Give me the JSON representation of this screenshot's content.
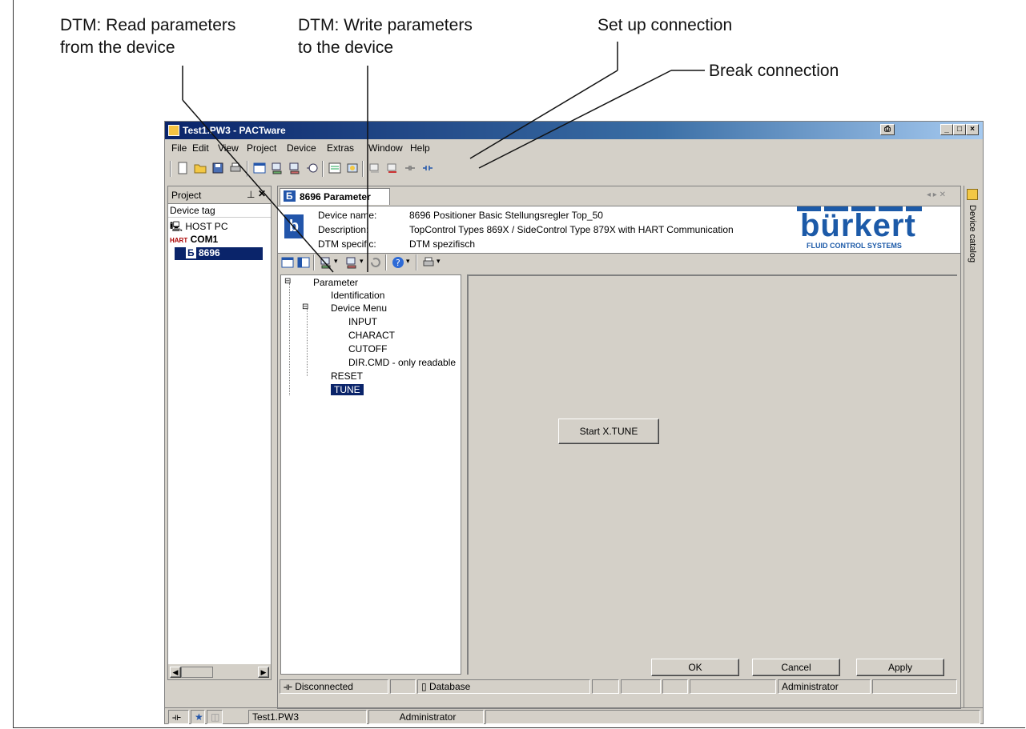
{
  "callouts": {
    "read_params": [
      "DTM: Read parameters",
      "from the device"
    ],
    "write_params": [
      "DTM: Write parameters",
      "to the device"
    ],
    "setup_conn": "Set up connection",
    "break_conn": "Break connection"
  },
  "window": {
    "title": "Test1.PW3 - PACTware",
    "buttons": [
      "_",
      "□",
      "×"
    ]
  },
  "menu": [
    "File",
    "Edit",
    "View",
    "Project",
    "Device",
    "Extras",
    "Window",
    "Help"
  ],
  "project_pane": {
    "title": "Project",
    "column_header": "Device tag",
    "tree": [
      {
        "label": "HOST PC",
        "icon": "computer-icon"
      },
      {
        "label": "COM1",
        "prefix": "HART",
        "icon": "hart-icon"
      },
      {
        "label": "8696",
        "icon": "device-icon",
        "selected": true
      }
    ]
  },
  "param_tab": {
    "label": "8696 Parameter"
  },
  "device_info": {
    "name_label": "Device name:",
    "name_value": "8696 Positioner Basic Stellungsregler Top_50",
    "desc_label": "Description:",
    "desc_value": "TopControl Types 869X / SideControl Type 879X  with HART Communication",
    "dtm_label": "DTM specific:",
    "dtm_value": "DTM spezifisch",
    "logo": "bürkert",
    "logo_sub": "FLUID CONTROL SYSTEMS"
  },
  "param_tree": {
    "root": "Parameter",
    "items": [
      "Identification",
      "Device Menu",
      "INPUT",
      "CHARACT",
      "CUTOFF",
      "DIR.CMD - only readable",
      "RESET",
      "TUNE"
    ]
  },
  "content": {
    "start_button": "Start X.TUNE"
  },
  "dialog_buttons": {
    "ok": "OK",
    "cancel": "Cancel",
    "apply": "Apply"
  },
  "statusbar": {
    "connection": "Disconnected",
    "database": "Database",
    "user": "Administrator"
  },
  "bottom": {
    "file": "Test1.PW3",
    "user": "Administrator"
  },
  "side_catalog": "Device catalog",
  "colors": {
    "title_start": "#0a246a",
    "title_end": "#a6caf0",
    "selection": "#0a246a",
    "logo_blue": "#1c5aa8"
  }
}
